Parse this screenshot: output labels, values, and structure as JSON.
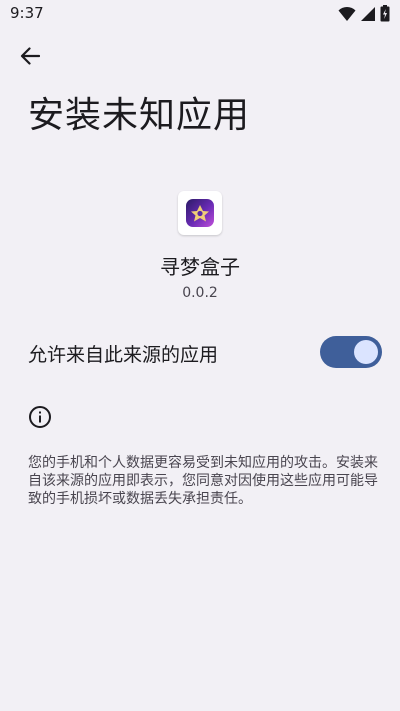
{
  "status_bar": {
    "time": "9:37",
    "icons": [
      "wifi-icon",
      "signal-icon",
      "battery-icon"
    ]
  },
  "header": {
    "back_icon": "arrow-back-icon",
    "title": "安装未知应用"
  },
  "app": {
    "name": "寻梦盒子",
    "version": "0.0.2"
  },
  "setting": {
    "label": "允许来自此来源的应用",
    "enabled": true
  },
  "info": {
    "icon": "info-icon",
    "warning": "您的手机和个人数据更容易受到未知应用的攻击。安装来自该来源的应用即表示，您同意对因使用这些应用可能导致的手机损坏或数据丢失承担责任。"
  },
  "colors": {
    "background": "#f2f0f5",
    "switch_track": "#3f5f9a",
    "switch_thumb": "#dbe4ff"
  }
}
